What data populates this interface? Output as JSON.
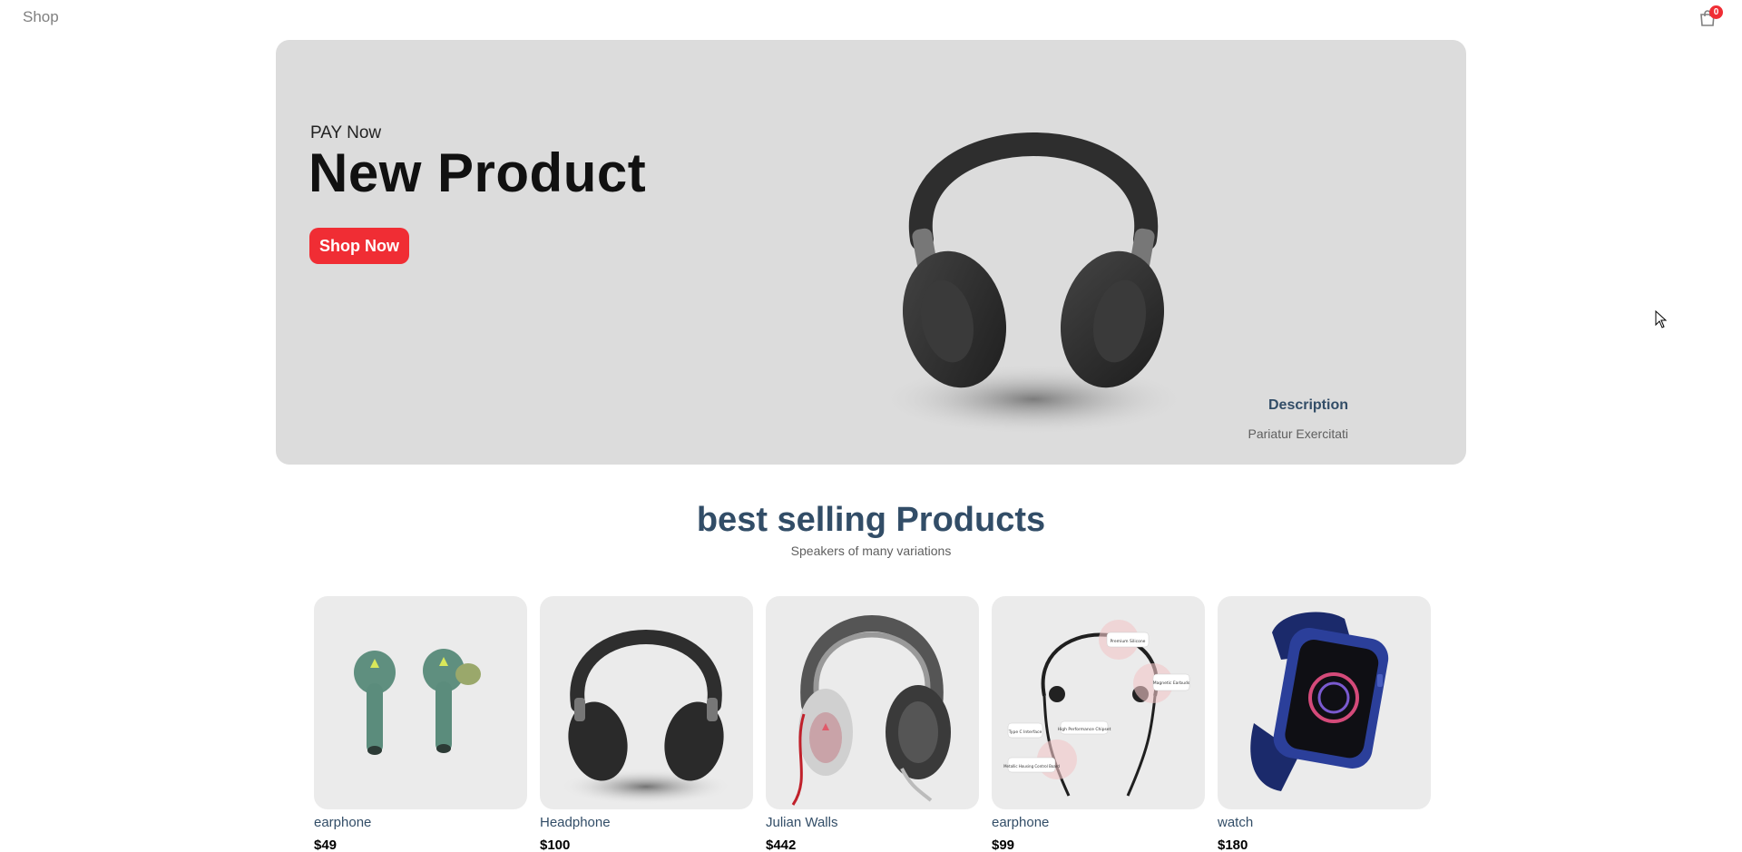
{
  "navbar": {
    "logo": "Shop",
    "cart_count": "0",
    "cart_icon": "shopping-bag-icon"
  },
  "hero": {
    "small_text": "PAY Now",
    "title": "New Product",
    "button_label": "Shop Now",
    "description_title": "Description",
    "description_text": "Pariatur Exercitati",
    "image": "headphones-image"
  },
  "section": {
    "title": "best selling Products",
    "subtitle": "Speakers of many variations"
  },
  "products": [
    {
      "name": "earphone",
      "price": "$49",
      "image": "earbuds-image"
    },
    {
      "name": "Headphone",
      "price": "$100",
      "image": "headphones-image"
    },
    {
      "name": "Julian Walls",
      "price": "$442",
      "image": "gaming-headset-image"
    },
    {
      "name": "earphone",
      "price": "$99",
      "image": "neckband-earphone-image"
    },
    {
      "name": "watch",
      "price": "$180",
      "image": "smartwatch-image"
    }
  ],
  "neckband_labels": [
    "Premium Silicone",
    "Magnetic Earbuds",
    "High Performance Chipset",
    "Type C Interface",
    "Metallic Housing Control Board"
  ],
  "colors": {
    "accent": "#f02d34",
    "heading": "#324d67",
    "hero_bg": "#dcdcdc",
    "card_bg": "#ebebeb"
  }
}
